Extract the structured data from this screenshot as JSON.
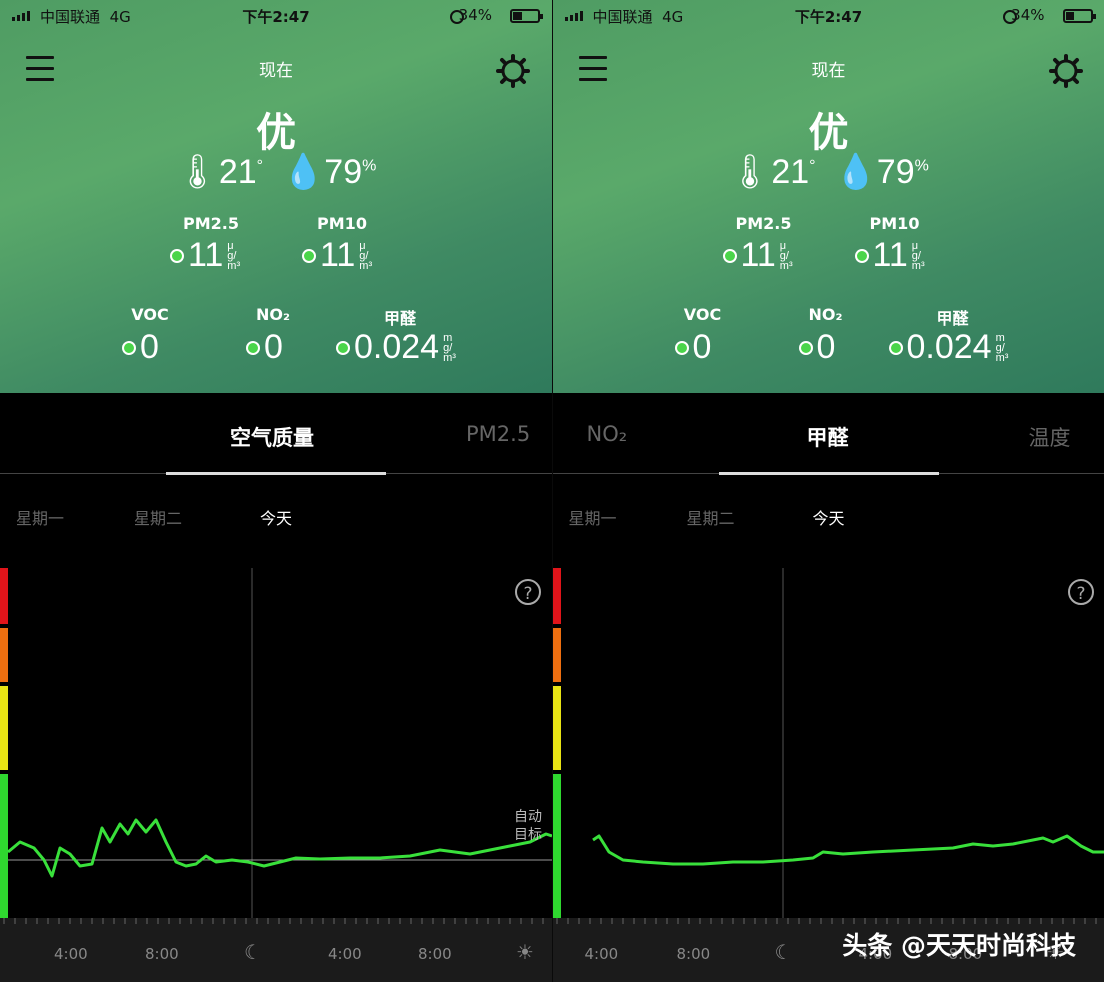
{
  "screens": [
    {
      "status": {
        "carrier": "中国联通",
        "network": "4G",
        "time": "下午2:47",
        "battery": "34%",
        "battery_level": 0.34
      },
      "header": {
        "title": "现在",
        "grade": "优",
        "temperature": "21",
        "temp_unit": "°",
        "humidity": "79",
        "humidity_unit": "%"
      },
      "pm": [
        {
          "label": "PM2.5",
          "value": "11",
          "unit": "μg/m³"
        },
        {
          "label": "PM10",
          "value": "11",
          "unit": "μg/m³"
        }
      ],
      "gases": [
        {
          "label": "VOC",
          "value": "0",
          "unit": ""
        },
        {
          "label": "NO₂",
          "value": "0",
          "unit": ""
        },
        {
          "label": "甲醛",
          "value": "0.024",
          "unit": "mg/m³"
        }
      ],
      "tabs": [
        {
          "label": "空气质量",
          "active": true
        },
        {
          "label": "PM2.5",
          "active": false
        }
      ],
      "days": [
        "星期一",
        "星期二",
        "今天"
      ],
      "chart_labels": {
        "help": "?",
        "auto": "自动目标"
      },
      "scale_labels": [
        "4:00",
        "8:00",
        "4:00",
        "8:00"
      ]
    },
    {
      "status": {
        "carrier": "中国联通",
        "network": "4G",
        "time": "下午2:47",
        "battery": "34%",
        "battery_level": 0.34
      },
      "header": {
        "title": "现在",
        "grade": "优",
        "temperature": "21",
        "temp_unit": "°",
        "humidity": "79",
        "humidity_unit": "%"
      },
      "pm": [
        {
          "label": "PM2.5",
          "value": "11",
          "unit": "μg/m³"
        },
        {
          "label": "PM10",
          "value": "11",
          "unit": "μg/m³"
        }
      ],
      "gases": [
        {
          "label": "VOC",
          "value": "0",
          "unit": ""
        },
        {
          "label": "NO₂",
          "value": "0",
          "unit": ""
        },
        {
          "label": "甲醛",
          "value": "0.024",
          "unit": "mg/m³"
        }
      ],
      "tabs": [
        {
          "label": "NO₂",
          "active": false
        },
        {
          "label": "甲醛",
          "active": true
        },
        {
          "label": "温度",
          "active": false
        }
      ],
      "days": [
        "星期一",
        "星期二",
        "今天"
      ],
      "chart_labels": {
        "help": "?"
      },
      "scale_labels": [
        "4:00",
        "8:00",
        "4:00",
        "8:00"
      ]
    }
  ],
  "watermark": "头条 @天天时尚科技",
  "colors": {
    "good": "#4ad54a",
    "line": "#39e03b",
    "band_red": "#e0141a",
    "band_orange": "#ee6f10",
    "band_yellow": "#e8e414",
    "band_green": "#2fd82f"
  }
}
